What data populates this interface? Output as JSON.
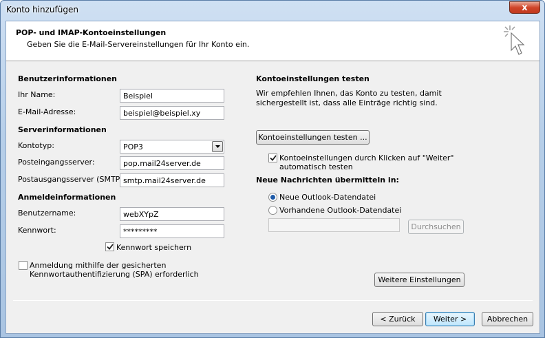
{
  "window": {
    "title": "Konto hinzufügen",
    "close_label": "x"
  },
  "header": {
    "title": "POP- und IMAP-Kontoeinstellungen",
    "subtitle": "Geben Sie die E-Mail-Servereinstellungen für Ihr Konto ein."
  },
  "user_info": {
    "heading": "Benutzerinformationen",
    "name_label": "Ihr Name:",
    "name_value": "Beispiel",
    "email_label": "E-Mail-Adresse:",
    "email_value": "beispiel@beispiel.xy"
  },
  "server_info": {
    "heading": "Serverinformationen",
    "account_type_label": "Kontotyp:",
    "account_type_value": "POP3",
    "incoming_label": "Posteingangsserver:",
    "incoming_value": "pop.mail24server.de",
    "outgoing_label": "Postausgangsserver (SMTP):",
    "outgoing_value": "smtp.mail24server.de"
  },
  "login_info": {
    "heading": "Anmeldeinformationen",
    "username_label": "Benutzername:",
    "username_value": "webXYpZ",
    "password_label": "Kennwort:",
    "password_value": "*********",
    "remember_label": "Kennwort speichern",
    "remember_checked": true,
    "spa_label_line1": "Anmeldung mithilfe der gesicherten",
    "spa_label_line2": "Kennwortauthentifizierung (SPA) erforderlich",
    "spa_checked": false
  },
  "test": {
    "heading": "Kontoeinstellungen testen",
    "description_line1": "Wir empfehlen Ihnen, das Konto zu testen, damit",
    "description_line2": "sichergestellt ist, dass alle Einträge richtig sind.",
    "test_button": "Kontoeinstellungen testen ...",
    "auto_test_line1": "Kontoeinstellungen durch Klicken auf \"Weiter\"",
    "auto_test_line2": "automatisch testen",
    "auto_test_checked": true
  },
  "deliver": {
    "heading": "Neue Nachrichten übermitteln in:",
    "option_new": "Neue Outlook-Datendatei",
    "option_existing": "Vorhandene Outlook-Datendatei",
    "selected": "new",
    "path_value": "",
    "browse_button": "Durchsuchen"
  },
  "more_settings_button": "Weitere Einstellungen",
  "footer": {
    "back_button": "< Zurück",
    "next_button": "Weiter >",
    "cancel_button": "Abbrechen"
  },
  "colors": {
    "radio_selected": "#1e5aa8",
    "check": "#1a1a1a",
    "close_button": "#c7442a"
  }
}
